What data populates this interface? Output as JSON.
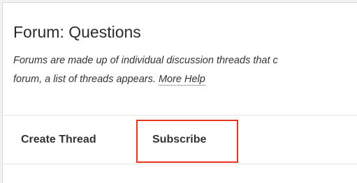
{
  "forum": {
    "title": "Forum: Questions",
    "description_line1": "Forums are made up of individual discussion threads that c",
    "description_line2_prefix": "forum, a list of threads appears. ",
    "help_link": "More Help"
  },
  "toolbar": {
    "create_thread_label": "Create Thread",
    "subscribe_label": "Subscribe"
  },
  "colors": {
    "highlight": "#e8361e"
  }
}
